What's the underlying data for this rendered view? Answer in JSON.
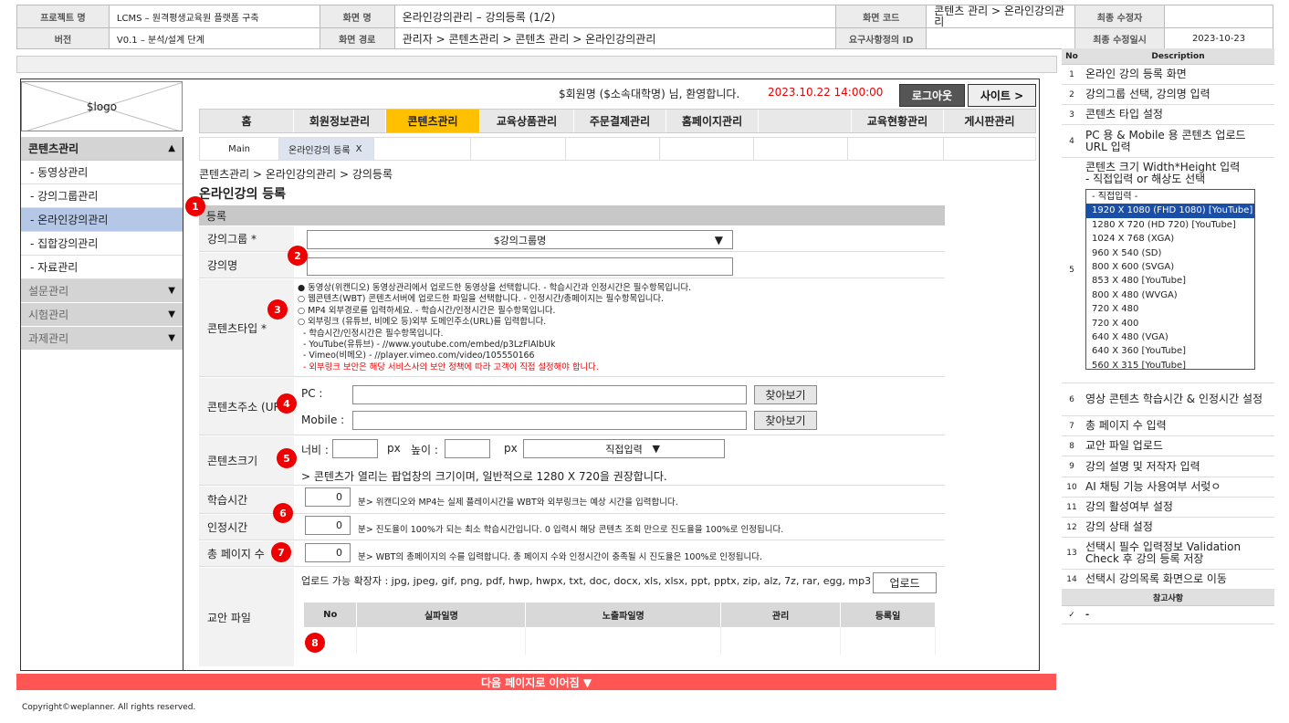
{
  "meta": {
    "project_label": "프로젝트 명",
    "project_value": "LCMS – 원격평생교육원 플랫폼 구축",
    "screen_name_label": "화면 명",
    "screen_name_value": "온라인강의관리 – 강의등록 (1/2)",
    "screen_code_label": "화면 코드",
    "screen_code_value": "콘텐츠 관리 > 온라인강의관리",
    "modifier_label": "최종 수정자",
    "modifier_value": "",
    "version_label": "버전",
    "version_value": "V0.1 – 분석/설계 단계",
    "screen_path_label": "화면 경로",
    "screen_path_value": "관리자 > 콘텐츠관리 > 콘텐츠 관리 > 온라인강의관리",
    "req_id_label": "요구사항정의 ID",
    "req_id_value": "",
    "modified_date_label": "최종 수정일시",
    "modified_date_value": "2023-10-23"
  },
  "logo": "$logo",
  "sidebar": {
    "title": "콘텐츠관리",
    "items": [
      {
        "label": "- 동영상관리"
      },
      {
        "label": "- 강의그룹관리"
      },
      {
        "label": "- 온라인강의관리"
      },
      {
        "label": "- 집합강의관리"
      },
      {
        "label": "- 자료관리"
      }
    ],
    "groups": [
      {
        "label": "설문관리"
      },
      {
        "label": "시험관리"
      },
      {
        "label": "과제관리"
      }
    ]
  },
  "top": {
    "welcome": "$회원명 ($소속대학명) 님, 환영합니다.",
    "datetime": "2023.10.22 14:00:00",
    "logout": "로그아웃",
    "site": "사이트 >"
  },
  "gnb": [
    {
      "label": "홈"
    },
    {
      "label": "회원정보관리"
    },
    {
      "label": "콘텐츠관리"
    },
    {
      "label": "교육상품관리"
    },
    {
      "label": "주문결제관리"
    },
    {
      "label": "홈페이지관리"
    },
    {
      "label": ""
    },
    {
      "label": "교육현황관리"
    },
    {
      "label": "게시판관리"
    }
  ],
  "tabs": {
    "main": "Main",
    "current": "온라인강의 등록",
    "close": "X"
  },
  "breadcrumb": "콘텐츠관리 > 온라인강의관리 > 강의등록",
  "page_title": "온라인강의 등록",
  "form": {
    "section": "등록",
    "group_label": "강의그룹 *",
    "group_select": "$강의그룹명",
    "name_label": "강의명",
    "type_label": "콘텐츠타입 *",
    "type_options": [
      "● 동영상(위캔디오) 동영상관리에서 업로드한 동영상을 선택합니다. - 학습시간과 인정시간은 필수항목입니다.",
      "○ 웹콘텐츠(WBT) 콘텐츠서버에 업로드한 파일을 선택합니다. - 인정시간/총페이지는 필수항목입니다.",
      "○ MP4 외부경로를 입력하세요. - 학습시간/인정시간은 필수항목입니다.",
      "○ 외부링크 (유튜브, 비메오 등)외부 도메인주소(URL)를 입력합니다."
    ],
    "type_notes": [
      "- 학습시간/인정시간은 필수항목입니다.",
      "- YouTube(유튜브) - //www.youtube.com/embed/p3LzFlAIbUk",
      "- Vimeo(비메오) - //player.vimeo.com/video/105550166"
    ],
    "type_warning": "- 외부링크 보안은 해당 서비스사의 보안 정책에 따라 고객이 직접 설정해야 합니다.",
    "url_label": "콘텐츠주소 (URL)",
    "pc_label": "PC :",
    "mobile_label": "Mobile :",
    "browse": "찾아보기",
    "size_label": "콘텐츠크기",
    "width_label": "너비 :",
    "height_label": "높이 :",
    "px": "px",
    "size_select": "직접입력",
    "size_note": "> 콘텐츠가 열리는 팝업창의 크기이며, 일반적으로 1280 X 720을 권장합니다.",
    "study_time_label": "학습시간",
    "study_time_value": "0",
    "study_time_note": "분> 위캔디오와 MP4는 실제 플레이시간을 WBT와 외부링크는 예상 시간을 입력합니다.",
    "cert_time_label": "인정시간",
    "cert_time_value": "0",
    "cert_time_note": "분> 진도율이 100%가 되는 최소 학습시간입니다. 0 입력시 해당 콘텐츠 조회 만으로 진도율을 100%로 인정됩니다.",
    "pages_label": "총 페이지 수",
    "pages_value": "0",
    "pages_note": "분> WBT의 총페이지의 수를 입력합니다. 총 페이지 수와 인정시간이 충족될 시 진도율은 100%로 인정됩니다.",
    "file_label": "교안 파일",
    "file_ext": "업로드 가능 확장자 : jpg, jpeg, gif, png, pdf, hwp, hwpx, txt, doc, docx, xls, xlsx, ppt, pptx, zip, alz, 7z, rar, egg, mp3",
    "upload": "업로드",
    "file_cols": [
      "No",
      "실파일명",
      "노출파일명",
      "관리",
      "등록일"
    ]
  },
  "badges": [
    "1",
    "2",
    "3",
    "4",
    "5",
    "6",
    "7",
    "8"
  ],
  "next_page": "다음 페이지로 이어짐 ▼",
  "copyright": "Copyright©weplanner. All rights reserved.",
  "desc": {
    "col_no": "No",
    "col_desc": "Description",
    "rows": [
      {
        "no": "1",
        "text": "온라인 강의 등록 화면"
      },
      {
        "no": "2",
        "text": "강의그룹 선택, 강의명 입력"
      },
      {
        "no": "3",
        "text": "콘텐츠 타입 설정"
      },
      {
        "no": "4",
        "text": "PC 용 & Mobile 용 콘텐츠 업로드 URL 입력"
      }
    ],
    "row5_no": "5",
    "row5_line1": "콘텐츠 크기 Width*Height 입력",
    "row5_line2": "- 직접입력 or 해상도 선택",
    "resolutions": [
      "- 직접입력 -",
      "1920 X 1080 (FHD 1080) [YouTube]",
      "1280 X 720 (HD 720) [YouTube]",
      "1024 X 768 (XGA)",
      "960 X 540 (SD)",
      "800 X 600 (SVGA)",
      "853 X 480 [YouTube]",
      "800 X 480 (WVGA)",
      "720 X 480",
      "720 X 400",
      "640 X 480 (VGA)",
      "640 X 360 [YouTube]",
      "560 X 315 [YouTube]"
    ],
    "rows_after": [
      {
        "no": "6",
        "text": "영상 콘텐츠 학습시간 & 인정시간 설정"
      },
      {
        "no": "7",
        "text": "총 페이지 수 입력"
      },
      {
        "no": "8",
        "text": "교안 파일 업로드"
      },
      {
        "no": "9",
        "text": "강의 설명 및 저작자 입력"
      },
      {
        "no": "10",
        "text": "AI 채팅 기능 사용여부 서렂ㅇ"
      },
      {
        "no": "11",
        "text": "강의 활성여부 설정"
      },
      {
        "no": "12",
        "text": "강의 상태 설정"
      },
      {
        "no": "13",
        "text": "선택시 필수 입력정보 Validation Check 후 강의 등록 저장"
      },
      {
        "no": "14",
        "text": "선택시 강의목록 화면으로 이동"
      }
    ],
    "notes_title": "참고사항",
    "notes_check": "✓",
    "notes_value": "-"
  }
}
